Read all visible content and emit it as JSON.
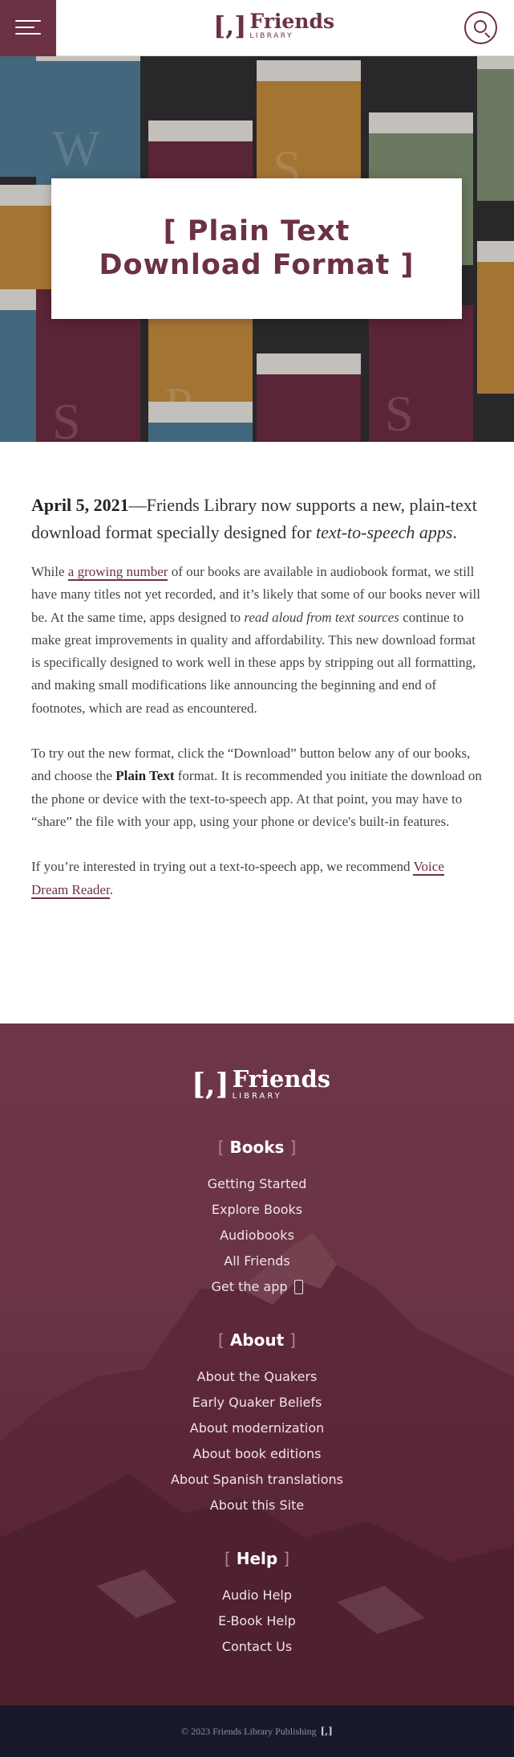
{
  "header": {
    "logo_bracket": "[,]",
    "logo_name": "Friends",
    "logo_sub": "LIBRARY"
  },
  "hero": {
    "title_line1": "[ Plain Text",
    "title_line2": "Download Format ]"
  },
  "article": {
    "lead_date": "April 5, 2021",
    "lead_dash": "—",
    "lead_text": "Friends Library now supports a new, plain-text download format specially designed for ",
    "lead_em": "text-to-speech apps",
    "lead_end": ".",
    "p1_start": "While ",
    "p1_link": "a growing number",
    "p1_mid": " of our books are available in audiobook format, we still have many titles not yet recorded, and it’s likely that some of our books never will be. At the same time, apps designed to ",
    "p1_em": "read aloud from text sources",
    "p1_end": " continue to make great improvements in quality and affordability. This new download format is specifically designed to work well in these apps by stripping out all formatting, and making small modifications like announcing the beginning and end of footnotes, which are read as encountered.",
    "p2_start": "To try out the new format, click the “Download” button below any of our books, and choose the ",
    "p2_strong": "Plain Text",
    "p2_end": " format. It is recommended you initiate the download on the phone or device with the text-to-speech app. At that point, you may have to “share” the file with your app, using your phone or device's built-in features.",
    "p3_start": "If you’re interested in trying out a text-to-speech app, we recommend ",
    "p3_link": "Voice Dream Reader",
    "p3_end": "."
  },
  "footer": {
    "logo_bracket": "[,]",
    "logo_name": "Friends",
    "logo_sub": "LIBRARY",
    "books": {
      "bracket_open": "[",
      "heading": "Books",
      "bracket_close": "]",
      "links": [
        "Getting Started",
        "Explore Books",
        "Audiobooks",
        "All Friends",
        "Get the app"
      ]
    },
    "about": {
      "bracket_open": "[",
      "heading": "About",
      "bracket_close": "]",
      "links": [
        "About the Quakers",
        "Early Quaker Beliefs",
        "About modernization",
        "About book editions",
        "About Spanish translations",
        "About this Site"
      ]
    },
    "help": {
      "bracket_open": "[",
      "heading": "Help",
      "bracket_close": "]",
      "links": [
        "Audio Help",
        "E-Book Help",
        "Contact Us"
      ]
    },
    "copyright": "© 2023 Friends Library Publishing",
    "copyright_mark": "[,]"
  },
  "colors": {
    "brand": "#6c3142",
    "footer_bottom": "#161a2b",
    "book_blue": "#4e7a93",
    "book_maroon": "#6a2a3d",
    "book_gold": "#c48a3a",
    "book_sage": "#7d9171"
  },
  "icons": [
    "menu-icon",
    "search-icon",
    "phone-icon"
  ]
}
